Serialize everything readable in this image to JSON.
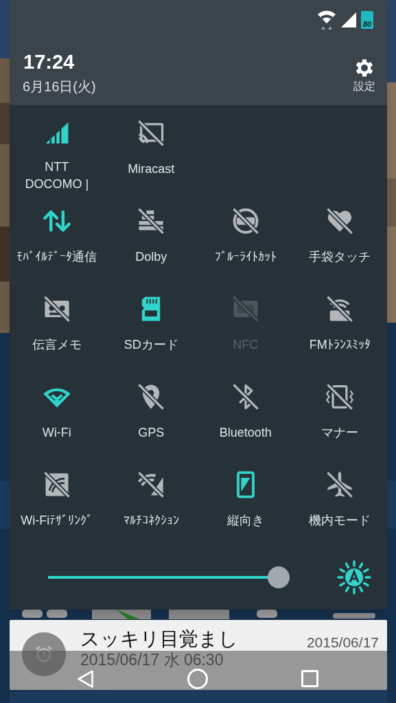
{
  "status_bar": {
    "battery": "80"
  },
  "header": {
    "time": "17:24",
    "date": "6月16日(火)",
    "settings_label": "設定"
  },
  "tile_rows": [
    [
      {
        "label": "NTT\nDOCOMO |",
        "on": true,
        "disabled": false
      },
      {
        "label": "Miracast",
        "on": false,
        "disabled": false
      }
    ],
    [
      {
        "label": "ﾓﾊﾞｲﾙﾃﾞｰﾀ通信",
        "on": true,
        "disabled": false
      },
      {
        "label": "Dolby",
        "on": false,
        "disabled": false
      },
      {
        "label": "ﾌﾞﾙｰﾗｲﾄｶｯﾄ",
        "on": false,
        "disabled": false
      },
      {
        "label": "手袋タッチ",
        "on": false,
        "disabled": false
      }
    ],
    [
      {
        "label": "伝言メモ",
        "on": false,
        "disabled": false
      },
      {
        "label": "SDカード",
        "on": true,
        "disabled": false
      },
      {
        "label": "NFC",
        "on": false,
        "disabled": true
      },
      {
        "label": "FMﾄﾗﾝｽﾐｯﾀ",
        "on": false,
        "disabled": false
      }
    ],
    [
      {
        "label": "Wi-Fi",
        "on": true,
        "disabled": false
      },
      {
        "label": "GPS",
        "on": false,
        "disabled": false
      },
      {
        "label": "Bluetooth",
        "on": false,
        "disabled": false
      },
      {
        "label": "マナー",
        "on": false,
        "disabled": false
      }
    ],
    [
      {
        "label": "Wi-Fiﾃｻﾞﾘﾝｸﾞ",
        "on": false,
        "disabled": false
      },
      {
        "label": "ﾏﾙﾁｺﾈｸｼｮﾝ",
        "on": false,
        "disabled": false
      },
      {
        "label": "縦向き",
        "on": true,
        "disabled": false
      },
      {
        "label": "機内モード",
        "on": false,
        "disabled": false
      }
    ]
  ],
  "brightness": {
    "level": 0.96,
    "auto": true
  },
  "notification": {
    "title": "スッキリ目覚まし",
    "date": "2015/06/17",
    "text": "2015/06/17 水 06:30"
  }
}
